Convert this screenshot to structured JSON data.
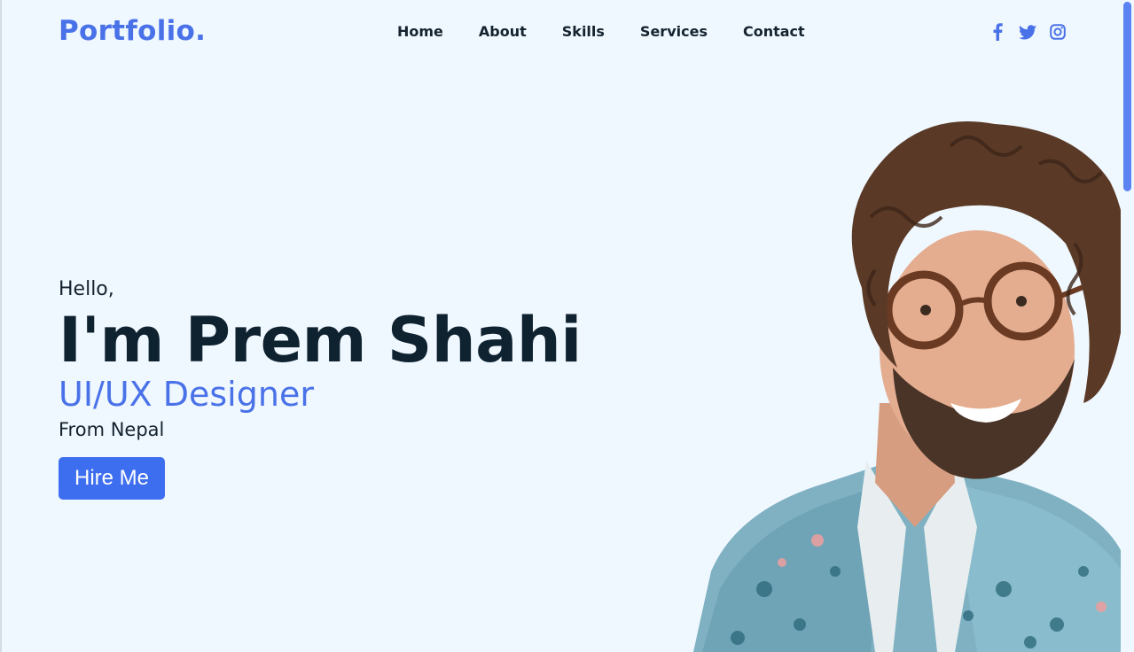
{
  "header": {
    "logo": "Portfolio.",
    "nav": [
      "Home",
      "About",
      "Skills",
      "Services",
      "Contact"
    ],
    "socials": [
      "facebook-icon",
      "twitter-icon",
      "instagram-icon"
    ]
  },
  "hero": {
    "greeting": "Hello,",
    "name": "I'm Prem Shahi",
    "role": "UI/UX Designer",
    "location": "From Nepal",
    "cta_label": "Hire Me"
  },
  "colors": {
    "accent": "#4a72e8",
    "button": "#3e6ef0",
    "background": "#f0f8ff",
    "text_dark": "#0f2230"
  }
}
